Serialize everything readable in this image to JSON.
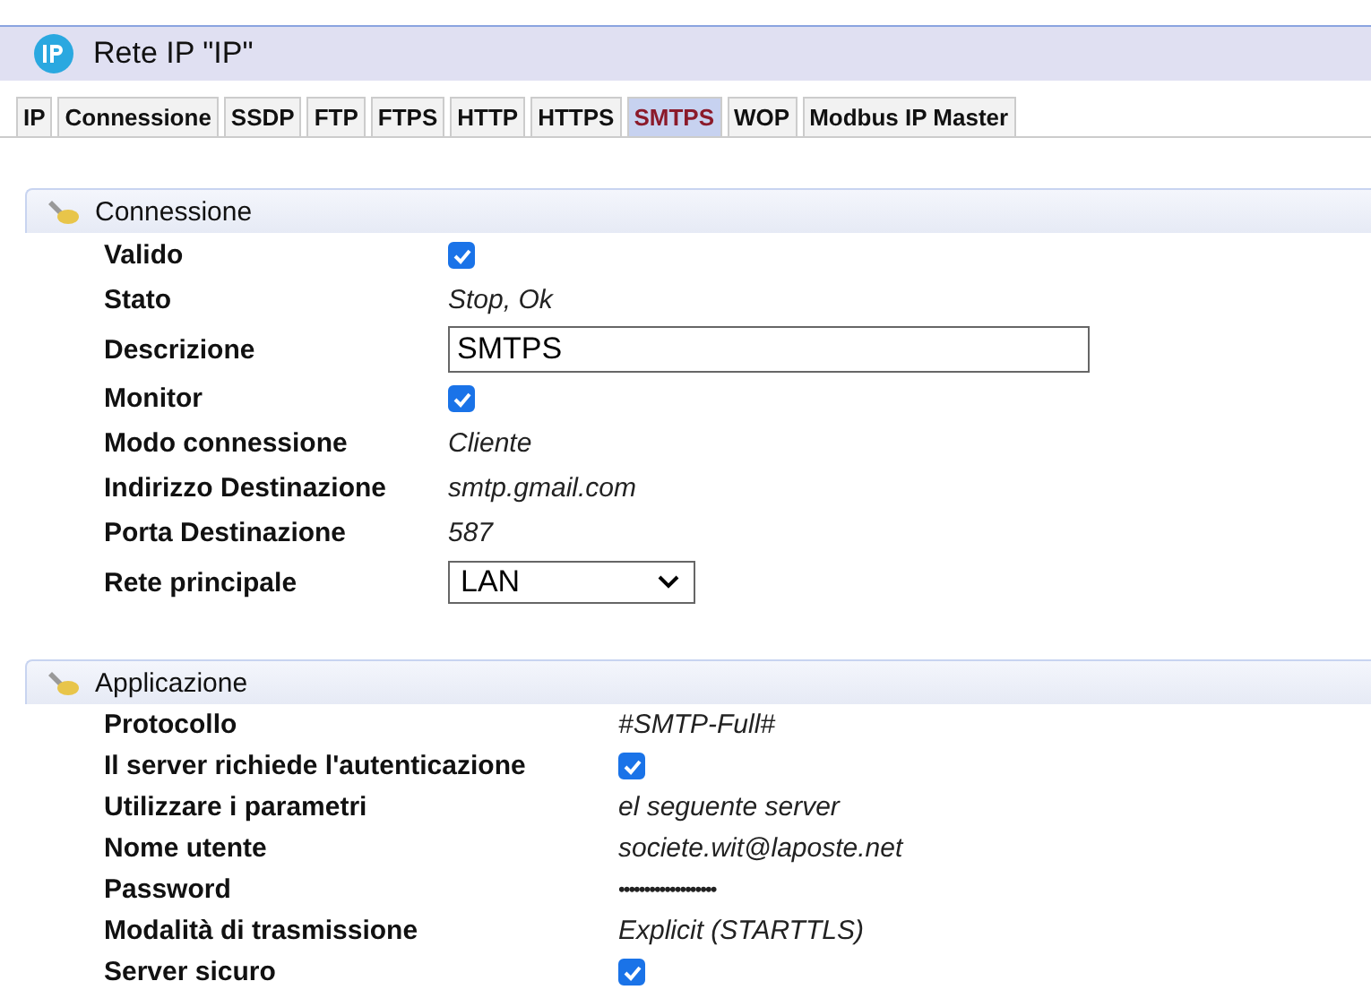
{
  "window": {
    "title": "Rete IP \"IP\""
  },
  "tabs": [
    {
      "label": "IP",
      "selected": false
    },
    {
      "label": "Connessione",
      "selected": false
    },
    {
      "label": "SSDP",
      "selected": false
    },
    {
      "label": "FTP",
      "selected": false
    },
    {
      "label": "FTPS",
      "selected": false
    },
    {
      "label": "HTTP",
      "selected": false
    },
    {
      "label": "HTTPS",
      "selected": false
    },
    {
      "label": "SMTPS",
      "selected": true
    },
    {
      "label": "WOP",
      "selected": false
    },
    {
      "label": "Modbus IP Master",
      "selected": false
    }
  ],
  "sections": [
    {
      "title": "Connessione",
      "wide": false,
      "rows": [
        {
          "label": "Valido",
          "kind": "check",
          "checked": true
        },
        {
          "label": "Stato",
          "kind": "text",
          "value": "Stop, Ok"
        },
        {
          "label": "Descrizione",
          "kind": "input",
          "value": "SMTPS"
        },
        {
          "label": "Monitor",
          "kind": "check",
          "checked": true
        },
        {
          "label": "Modo connessione",
          "kind": "text",
          "value": "Cliente"
        },
        {
          "label": "Indirizzo Destinazione",
          "kind": "text",
          "value": "smtp.gmail.com"
        },
        {
          "label": "Porta Destinazione",
          "kind": "text",
          "value": "587"
        },
        {
          "label": "Rete principale",
          "kind": "select",
          "value": "LAN"
        }
      ]
    },
    {
      "title": "Applicazione",
      "wide": true,
      "rows": [
        {
          "label": "Protocollo",
          "kind": "text",
          "value": "#SMTP-Full#"
        },
        {
          "label": "Il server richiede l'autenticazione",
          "kind": "check",
          "checked": true
        },
        {
          "label": "Utilizzare i parametri",
          "kind": "text",
          "value": "el seguente server"
        },
        {
          "label": "Nome utente",
          "kind": "text",
          "value": "societe.wit@laposte.net"
        },
        {
          "label": "Password",
          "kind": "password",
          "value": "•••••••••••••••••••"
        },
        {
          "label": "Modalità di trasmissione",
          "kind": "text",
          "value": "Explicit (STARTTLS)"
        },
        {
          "label": "Server sicuro",
          "kind": "check",
          "checked": true
        }
      ]
    }
  ]
}
